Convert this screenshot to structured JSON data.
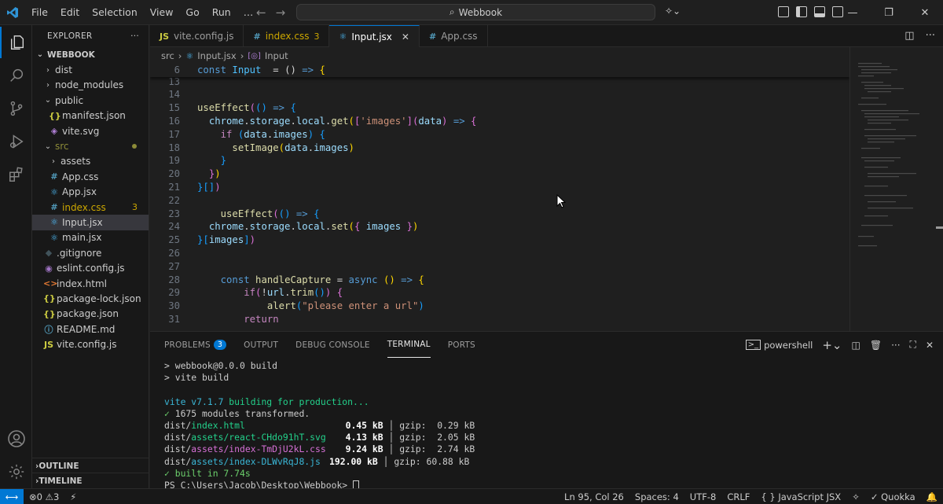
{
  "titlebar": {
    "menu": [
      "File",
      "Edit",
      "Selection",
      "View",
      "Go",
      "Run",
      "…"
    ],
    "search": "Webbook"
  },
  "sidebar": {
    "header": "EXPLORER",
    "more": "···",
    "root": "WEBBOOK",
    "items": [
      {
        "label": "dist",
        "type": "folder",
        "open": false,
        "depth": 1
      },
      {
        "label": "node_modules",
        "type": "folder",
        "open": false,
        "depth": 1
      },
      {
        "label": "public",
        "type": "folder",
        "open": true,
        "depth": 1
      },
      {
        "label": "manifest.json",
        "type": "json",
        "depth": 2
      },
      {
        "label": "vite.svg",
        "type": "svg",
        "depth": 2
      },
      {
        "label": "src",
        "type": "folder",
        "open": true,
        "depth": 1,
        "modified": true
      },
      {
        "label": "assets",
        "type": "folder",
        "open": false,
        "depth": 2
      },
      {
        "label": "App.css",
        "type": "css",
        "depth": 2
      },
      {
        "label": "App.jsx",
        "type": "jsx",
        "depth": 2
      },
      {
        "label": "index.css",
        "type": "css",
        "depth": 2,
        "badge": "3",
        "warn": true
      },
      {
        "label": "Input.jsx",
        "type": "jsx",
        "depth": 2,
        "selected": true
      },
      {
        "label": "main.jsx",
        "type": "jsx",
        "depth": 2
      },
      {
        "label": ".gitignore",
        "type": "git",
        "depth": 1
      },
      {
        "label": "eslint.config.js",
        "type": "eslint",
        "depth": 1
      },
      {
        "label": "index.html",
        "type": "html",
        "depth": 1
      },
      {
        "label": "package-lock.json",
        "type": "json",
        "depth": 1
      },
      {
        "label": "package.json",
        "type": "json",
        "depth": 1
      },
      {
        "label": "README.md",
        "type": "info",
        "depth": 1
      },
      {
        "label": "vite.config.js",
        "type": "js",
        "depth": 1
      }
    ],
    "outline": "OUTLINE",
    "timeline": "TIMELINE"
  },
  "tabs": [
    {
      "label": "vite.config.js",
      "icon": "js"
    },
    {
      "label": "index.css",
      "icon": "css",
      "badge": "3"
    },
    {
      "label": "Input.jsx",
      "icon": "jsx",
      "active": true
    },
    {
      "label": "App.css",
      "icon": "css"
    }
  ],
  "breadcrumb": {
    "folder": "src",
    "file": "Input.jsx",
    "symbol": "Input"
  },
  "editor": {
    "sticky": {
      "num": "6",
      "tokens": [
        [
          "kw",
          "const "
        ],
        [
          "cst",
          "Input"
        ],
        [
          "",
          "  = () "
        ],
        [
          "kw",
          "=>"
        ],
        [
          "",
          " "
        ],
        [
          "pn",
          "{"
        ]
      ]
    },
    "lines": [
      {
        "num": "13",
        "tokens": []
      },
      {
        "num": "14",
        "tokens": []
      },
      {
        "num": "15",
        "tokens": [
          [
            "fn",
            "useEffect"
          ],
          [
            "pn2",
            "("
          ],
          [
            "pn3",
            "()"
          ],
          [
            "",
            " "
          ],
          [
            "kw",
            "=>"
          ],
          [
            "",
            " "
          ],
          [
            "pn3",
            "{"
          ]
        ]
      },
      {
        "num": "16",
        "tokens": [
          [
            "",
            "  "
          ],
          [
            "var",
            "chrome"
          ],
          [
            "",
            "."
          ],
          [
            "var",
            "storage"
          ],
          [
            "",
            "."
          ],
          [
            "var",
            "local"
          ],
          [
            "",
            "."
          ],
          [
            "fn",
            "get"
          ],
          [
            "pn",
            "("
          ],
          [
            "pn2",
            "["
          ],
          [
            "str",
            "'images'"
          ],
          [
            "pn2",
            "]"
          ],
          [
            ", "
          ],
          [
            "pn2",
            "("
          ],
          [
            "var",
            "data"
          ],
          [
            "pn2",
            ")"
          ],
          [
            "",
            " "
          ],
          [
            "kw",
            "=>"
          ],
          [
            "",
            " "
          ],
          [
            "pn2",
            "{"
          ]
        ]
      },
      {
        "num": "17",
        "tokens": [
          [
            "",
            "    "
          ],
          [
            "ctl",
            "if"
          ],
          [
            "",
            " "
          ],
          [
            "pn3",
            "("
          ],
          [
            "var",
            "data"
          ],
          [
            "",
            "."
          ],
          [
            "var",
            "images"
          ],
          [
            "pn3",
            ")"
          ],
          [
            "",
            " "
          ],
          [
            "pn3",
            "{"
          ]
        ]
      },
      {
        "num": "18",
        "tokens": [
          [
            "",
            "      "
          ],
          [
            "fn",
            "setImage"
          ],
          [
            "pn",
            "("
          ],
          [
            "var",
            "data"
          ],
          [
            "",
            "."
          ],
          [
            "var",
            "images"
          ],
          [
            "pn",
            ")"
          ],
          [
            ";"
          ]
        ]
      },
      {
        "num": "19",
        "tokens": [
          [
            "",
            "    "
          ],
          [
            "pn3",
            "}"
          ]
        ]
      },
      {
        "num": "20",
        "tokens": [
          [
            "",
            "  "
          ],
          [
            "pn2",
            "}"
          ],
          [
            "pn",
            ")"
          ],
          [
            ";"
          ]
        ]
      },
      {
        "num": "21",
        "tokens": [
          [
            "pn3",
            "}"
          ],
          [
            ", "
          ],
          [
            "pn3",
            "[]"
          ],
          [
            "pn2",
            ")"
          ],
          [
            ";"
          ]
        ]
      },
      {
        "num": "22",
        "tokens": []
      },
      {
        "num": "23",
        "tokens": [
          [
            "",
            "    "
          ],
          [
            "fn",
            "useEffect"
          ],
          [
            "pn2",
            "("
          ],
          [
            "pn3",
            "()"
          ],
          [
            "",
            " "
          ],
          [
            "kw",
            "=>"
          ],
          [
            "",
            " "
          ],
          [
            "pn3",
            "{"
          ]
        ]
      },
      {
        "num": "24",
        "tokens": [
          [
            "",
            "  "
          ],
          [
            "var",
            "chrome"
          ],
          [
            "",
            "."
          ],
          [
            "var",
            "storage"
          ],
          [
            "",
            "."
          ],
          [
            "var",
            "local"
          ],
          [
            "",
            "."
          ],
          [
            "fn",
            "set"
          ],
          [
            "pn",
            "("
          ],
          [
            "pn2",
            "{"
          ],
          [
            "",
            " "
          ],
          [
            "var",
            "images"
          ],
          [
            "",
            " "
          ],
          [
            "pn2",
            "}"
          ],
          [
            "pn",
            ")"
          ]
        ]
      },
      {
        "num": "25",
        "tokens": [
          [
            "pn3",
            "}"
          ],
          [
            ", "
          ],
          [
            "pn3",
            "["
          ],
          [
            "var",
            "images"
          ],
          [
            "pn3",
            "]"
          ],
          [
            "pn2",
            ")"
          ]
        ]
      },
      {
        "num": "26",
        "tokens": []
      },
      {
        "num": "27",
        "tokens": []
      },
      {
        "num": "28",
        "tokens": [
          [
            "",
            "    "
          ],
          [
            "kw",
            "const "
          ],
          [
            "fn",
            "handleCapture"
          ],
          [
            "",
            " = "
          ],
          [
            "kw",
            "async"
          ],
          [
            "",
            " "
          ],
          [
            "pn",
            "()"
          ],
          [
            "",
            " "
          ],
          [
            "kw",
            "=>"
          ],
          [
            "",
            " "
          ],
          [
            "pn",
            "{"
          ]
        ]
      },
      {
        "num": "29",
        "tokens": [
          [
            "",
            "        "
          ],
          [
            "ctl",
            "if"
          ],
          [
            "pn2",
            "("
          ],
          [
            "",
            "!"
          ],
          [
            "var",
            "url"
          ],
          [
            "",
            "."
          ],
          [
            "fn",
            "trim"
          ],
          [
            "pn3",
            "()"
          ],
          [
            "pn2",
            ")"
          ],
          [
            "",
            " "
          ],
          [
            "pn2",
            "{"
          ]
        ]
      },
      {
        "num": "30",
        "tokens": [
          [
            "",
            "            "
          ],
          [
            "fn",
            "alert"
          ],
          [
            "pn3",
            "("
          ],
          [
            "str",
            "\"please enter a url\""
          ],
          [
            "pn3",
            ")"
          ]
        ]
      },
      {
        "num": "31",
        "tokens": [
          [
            "",
            "        "
          ],
          [
            "ctl",
            "return"
          ]
        ]
      }
    ]
  },
  "panel": {
    "tabs": [
      {
        "label": "PROBLEMS",
        "badge": "3"
      },
      {
        "label": "OUTPUT"
      },
      {
        "label": "DEBUG CONSOLE"
      },
      {
        "label": "TERMINAL",
        "active": true
      },
      {
        "label": "PORTS"
      }
    ],
    "shell": "powershell"
  },
  "terminal": {
    "cmd1": "> webbook@0.0.0 build",
    "cmd2": "> vite build",
    "vite_name": "vite v7.1.7",
    "vite_rest": " building for production...",
    "check": "✓",
    "transformed": " 1675 modules transformed.",
    "files": [
      {
        "dir": "dist/",
        "name": "index.html",
        "color": "green",
        "pad": "                ",
        "size": "0.45 kB",
        "gzip": "gzip:  0.29 kB"
      },
      {
        "dir": "dist/",
        "name": "assets/react-CHdo91hT.svg",
        "color": "green",
        "pad": " ",
        "size": "4.13 kB",
        "gzip": "gzip:  2.05 kB"
      },
      {
        "dir": "dist/",
        "name": "assets/index-TmDjU2kL.css",
        "color": "magenta",
        "pad": " ",
        "size": "9.24 kB",
        "gzip": "gzip:  2.74 kB"
      },
      {
        "dir": "dist/",
        "name": "assets/index-DLWvRqJ8.js",
        "color": "cyan",
        "pad": " ",
        "size": "192.00 kB",
        "gzip": "gzip: 60.88 kB"
      }
    ],
    "built": " built in 7.74s",
    "prompt": "PS C:\\Users\\Jacob\\Desktop\\Webbook> "
  },
  "statusbar": {
    "errors": "0",
    "warnings": "3",
    "position": "Ln 95, Col 26",
    "spaces": "Spaces: 4",
    "encoding": "UTF-8",
    "eol": "CRLF",
    "language": "JavaScript JSX",
    "quokka": "Quokka"
  },
  "colors": {
    "accent": "#0078d4",
    "background": "#1f1f1f",
    "sidebar": "#181818"
  }
}
